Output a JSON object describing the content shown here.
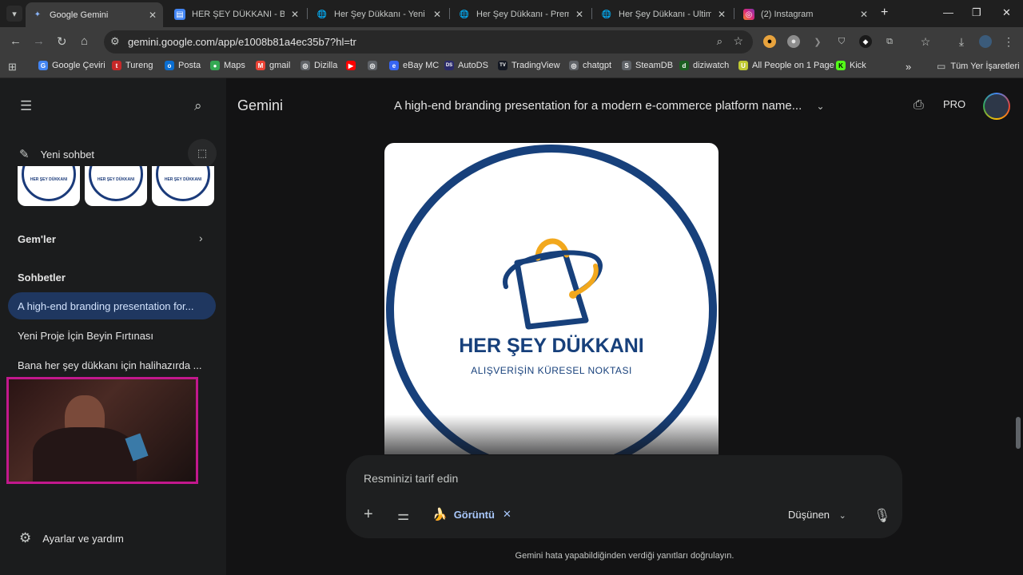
{
  "browser": {
    "tabs": [
      {
        "title": "Google Gemini",
        "icon": "gemini-icon",
        "active": true
      },
      {
        "title": "HER ŞEY DÜKKANI - Belge",
        "icon": "docs-icon"
      },
      {
        "title": "Her Şey Dükkanı - Yeni Ko",
        "icon": "globe-icon"
      },
      {
        "title": "Her Şey Dükkanı - Premium",
        "icon": "globe-icon"
      },
      {
        "title": "Her Şey Dükkanı - Ultimate",
        "icon": "globe-icon"
      },
      {
        "title": "(2) Instagram",
        "icon": "instagram-icon"
      }
    ],
    "new_tab": "+",
    "url": "gemini.google.com/app/e1008b81a4ec35b7?hl=tr",
    "bookmarks": [
      {
        "label": "Google Çeviri",
        "color": "#4285f4",
        "glyph": "G"
      },
      {
        "label": "Tureng",
        "color": "#c62828",
        "glyph": "t"
      },
      {
        "label": "Posta",
        "color": "#0a6ed1",
        "glyph": "o"
      },
      {
        "label": "Maps",
        "color": "#34a853",
        "glyph": "●"
      },
      {
        "label": "gmail",
        "color": "#ea4335",
        "glyph": "M"
      },
      {
        "label": "Dizilla",
        "color": "#9aa0a6",
        "glyph": "◎"
      },
      {
        "label": "",
        "color": "#ff0000",
        "glyph": "▶"
      },
      {
        "label": "",
        "color": "#9aa0a6",
        "glyph": "◎"
      },
      {
        "label": "eBay MC",
        "color": "#3665f3",
        "glyph": "e"
      },
      {
        "label": "AutoDS",
        "color": "#2a2a6a",
        "glyph": "DS"
      },
      {
        "label": "TradingView",
        "color": "#131722",
        "glyph": "TV"
      },
      {
        "label": "chatgpt",
        "color": "#9aa0a6",
        "glyph": "◎"
      },
      {
        "label": "SteamDB",
        "color": "#9aa0a6",
        "glyph": "S"
      },
      {
        "label": "diziwatch",
        "color": "#1b5e20",
        "glyph": "d"
      },
      {
        "label": "All People on 1 Page",
        "color": "#c0ca33",
        "glyph": "U"
      },
      {
        "label": "Kick",
        "color": "#53fc18",
        "glyph": "K"
      }
    ],
    "bookmarks_overflow": "»",
    "all_bookmarks": "Tüm Yer İşaretleri"
  },
  "sidebar": {
    "new_chat": "Yeni sohbet",
    "thumb_label": "HER ŞEY DÜKKANI",
    "gems_heading": "Gem'ler",
    "chats_heading": "Sohbetler",
    "chats": [
      {
        "title": "A high-end branding presentation for...",
        "active": true
      },
      {
        "title": "Yeni Proje İçin Beyin Fırtınası"
      },
      {
        "title": "Bana her şey dükkanı için halihazırda ..."
      }
    ],
    "settings": "Ayarlar ve yardım"
  },
  "header": {
    "brand": "Gemini",
    "conversation_title": "A high-end branding presentation for a modern e-commerce platform name...",
    "pro_label": "PRO"
  },
  "image": {
    "brand_name": "HER ŞEY DÜKKANI",
    "tagline": "ALIŞVERİŞİN KÜRESEL NOKTASI",
    "primary_color": "#17407b",
    "accent_color": "#f2a81d"
  },
  "composer": {
    "placeholder": "Resminizi tarif edin",
    "tool_chip": "Görüntü",
    "mode": "Düşünen"
  },
  "disclaimer": "Gemini hata yapabildiğinden verdiği yanıtları doğrulayın."
}
